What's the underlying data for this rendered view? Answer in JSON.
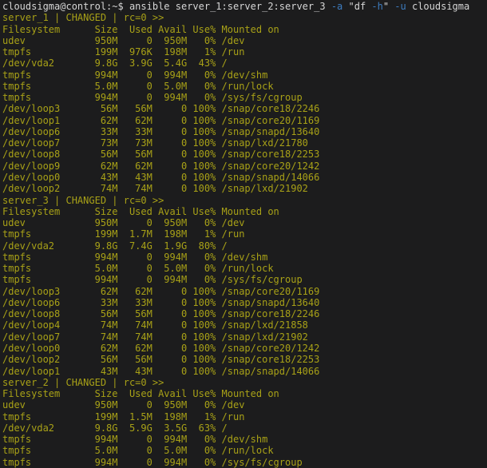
{
  "colors": {
    "background": "#1c1c1d",
    "foreground": "#d6d6d6",
    "yellow": "#a8a117",
    "blue": "#3d7cc0"
  },
  "prompt": {
    "user_host": "cloudsigma@control:~$",
    "segments": [
      {
        "text": "cloudsigma@control:~$ ansible server_1:server_2:server_3 ",
        "style": "fg"
      },
      {
        "text": "-a",
        "style": "blue"
      },
      {
        "text": " \"df ",
        "style": "fg"
      },
      {
        "text": "-h",
        "style": "blue"
      },
      {
        "text": "\" ",
        "style": "fg"
      },
      {
        "text": "-u",
        "style": "blue"
      },
      {
        "text": " cloudsigma",
        "style": "fg"
      }
    ]
  },
  "sections": [
    {
      "host": "server_1",
      "status": "CHANGED",
      "rc": "rc=0",
      "header": "server_1 | CHANGED | rc=0 >>",
      "lines": [
        "Filesystem      Size  Used Avail Use% Mounted on",
        "udev            950M     0  950M   0% /dev",
        "tmpfs           199M  976K  198M   1% /run",
        "/dev/vda2       9.8G  3.9G  5.4G  43% /",
        "tmpfs           994M     0  994M   0% /dev/shm",
        "tmpfs           5.0M     0  5.0M   0% /run/lock",
        "tmpfs           994M     0  994M   0% /sys/fs/cgroup",
        "/dev/loop3       56M   56M     0 100% /snap/core18/2246",
        "/dev/loop1       62M   62M     0 100% /snap/core20/1169",
        "/dev/loop6       33M   33M     0 100% /snap/snapd/13640",
        "/dev/loop7       73M   73M     0 100% /snap/lxd/21780",
        "/dev/loop8       56M   56M     0 100% /snap/core18/2253",
        "/dev/loop9       62M   62M     0 100% /snap/core20/1242",
        "/dev/loop0       43M   43M     0 100% /snap/snapd/14066",
        "/dev/loop2       74M   74M     0 100% /snap/lxd/21902"
      ]
    },
    {
      "host": "server_3",
      "status": "CHANGED",
      "rc": "rc=0",
      "header": "server_3 | CHANGED | rc=0 >>",
      "lines": [
        "Filesystem      Size  Used Avail Use% Mounted on",
        "udev            950M     0  950M   0% /dev",
        "tmpfs           199M  1.7M  198M   1% /run",
        "/dev/vda2       9.8G  7.4G  1.9G  80% /",
        "tmpfs           994M     0  994M   0% /dev/shm",
        "tmpfs           5.0M     0  5.0M   0% /run/lock",
        "tmpfs           994M     0  994M   0% /sys/fs/cgroup",
        "/dev/loop3       62M   62M     0 100% /snap/core20/1169",
        "/dev/loop6       33M   33M     0 100% /snap/snapd/13640",
        "/dev/loop8       56M   56M     0 100% /snap/core18/2246",
        "/dev/loop4       74M   74M     0 100% /snap/lxd/21858",
        "/dev/loop7       74M   74M     0 100% /snap/lxd/21902",
        "/dev/loop0       62M   62M     0 100% /snap/core20/1242",
        "/dev/loop2       56M   56M     0 100% /snap/core18/2253",
        "/dev/loop1       43M   43M     0 100% /snap/snapd/14066"
      ]
    },
    {
      "host": "server_2",
      "status": "CHANGED",
      "rc": "rc=0",
      "header": "server_2 | CHANGED | rc=0 >>",
      "lines": [
        "Filesystem      Size  Used Avail Use% Mounted on",
        "udev            950M     0  950M   0% /dev",
        "tmpfs           199M  1.5M  198M   1% /run",
        "/dev/vda2       9.8G  5.9G  3.5G  63% /",
        "tmpfs           994M     0  994M   0% /dev/shm",
        "tmpfs           5.0M     0  5.0M   0% /run/lock",
        "tmpfs           994M     0  994M   0% /sys/fs/cgroup"
      ]
    }
  ]
}
